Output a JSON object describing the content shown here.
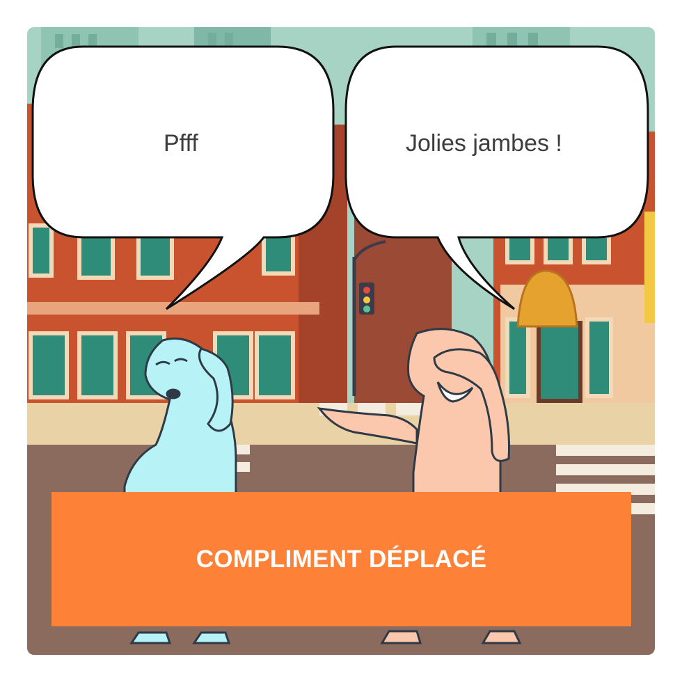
{
  "speech": {
    "left_character": "Pfff",
    "right_character": "Jolies jambes !"
  },
  "banner": {
    "label": "COMPLIMENT DÉPLACÉ"
  },
  "colors": {
    "banner": "#fd8237",
    "left_character": "#b6f2f6",
    "right_character": "#fcc8ad",
    "brick": "#c9532f",
    "sky": "#a7d3c5"
  },
  "icons": {
    "scene": "street-scene-illustration"
  }
}
